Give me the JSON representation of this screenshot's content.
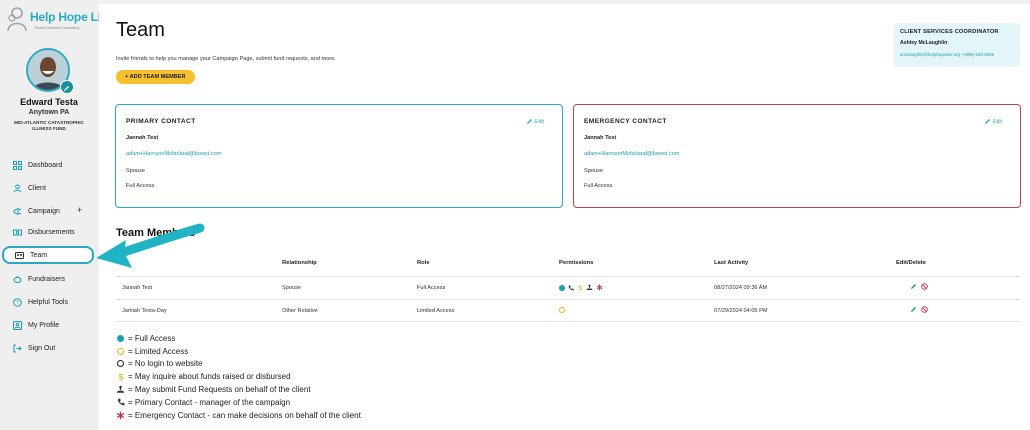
{
  "brand": {
    "name": "Help Hope Live",
    "tagline": "Trusted Medical Fundraising",
    "accent": "#2aaac0",
    "button_color": "#f6bf2e",
    "emergency_color": "#b0465a"
  },
  "user": {
    "name": "Edward Testa",
    "location": "Anytown PA",
    "fund": "MID-ATLANTIC CATASTROPHIC ILLNESS FUND"
  },
  "sidebar": {
    "items": [
      {
        "label": "Dashboard",
        "icon": "grid-icon"
      },
      {
        "label": "Client",
        "icon": "person-icon"
      },
      {
        "label": "Campaign",
        "icon": "megaphone-icon",
        "expand": "+"
      },
      {
        "label": "Disbursements",
        "icon": "money-icon"
      },
      {
        "label": "Team",
        "icon": "team-icon",
        "active": true
      },
      {
        "label": "Fundraisers",
        "icon": "piggy-bank-icon"
      },
      {
        "label": "Helpful Tools",
        "icon": "help-icon"
      },
      {
        "label": "My Profile",
        "icon": "profile-icon"
      },
      {
        "label": "Sign Out",
        "icon": "sign-out-icon"
      }
    ]
  },
  "page": {
    "title": "Team",
    "subtitle": "Invite friends to help you manage your Campaign Page, submit fund requests, and more.",
    "add_button": "+ ADD TEAM MEMBER"
  },
  "coordinator": {
    "title": "CLIENT SERVICES COORDINATOR",
    "name": "Ashley McLaughlin",
    "contact": "amclaughlin@helphopelive.org • (800) 642-8399"
  },
  "primary_contact": {
    "label": "PRIMARY CONTACT",
    "edit": "Edit",
    "name": "Jannah Test",
    "email": "adam+HarrisonMcfarland@bowst.com",
    "relationship": "Spouse",
    "access": "Full Access"
  },
  "emergency_contact": {
    "label": "EMERGENCY CONTACT",
    "edit": "Edit",
    "name": "Jannah Test",
    "email": "adam+HarrisonMcfarland@bowst.com",
    "relationship": "Spouse",
    "access": "Full Access"
  },
  "team_members": {
    "title": "Team Members",
    "columns": [
      "Relationship",
      "Role",
      "Permissions",
      "Last Activity",
      "Edit/Delete"
    ],
    "rows": [
      {
        "name": "Jannah Test",
        "relationship": "Spouse",
        "role": "Full Access",
        "last_activity": "08/27/2024 09:36 AM"
      },
      {
        "name": "Jamiah Testa-Day",
        "relationship": "Other Relative",
        "role": "Limited Access",
        "last_activity": "07/29/2024 04:05 PM"
      }
    ]
  },
  "legend": [
    {
      "icon": "full-access-icon",
      "text": "= Full Access"
    },
    {
      "icon": "limited-access-icon",
      "text": "= Limited Access"
    },
    {
      "icon": "no-login-icon",
      "text": "= No login to website"
    },
    {
      "icon": "dollar-icon",
      "text": "= May inquire about funds raised or disbursed"
    },
    {
      "icon": "fund-request-icon",
      "text": "= May submit Fund Requests on behalf of the client"
    },
    {
      "icon": "phone-icon",
      "text": "= Primary Contact - manager of the campaign"
    },
    {
      "icon": "asterisk-icon",
      "text": "= Emergency Contact - can make decisions on behalf of the client"
    }
  ]
}
